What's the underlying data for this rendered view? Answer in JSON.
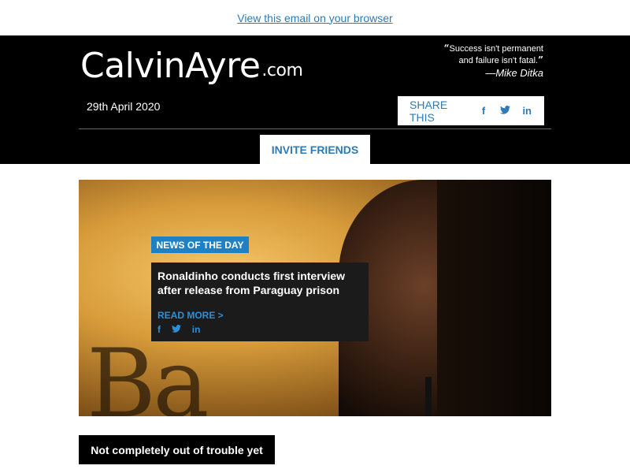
{
  "browser_link": "View this email on your browser",
  "header": {
    "logo_main": "CalvinAyre",
    "logo_suffix": ".com",
    "quote_line1": "Success isn't permanent",
    "quote_line2": "and failure isn't fatal.",
    "quote_open": "“",
    "quote_close": "”",
    "quote_author": "—Mike Ditka",
    "date": "29th April 2020",
    "share_label": "SHARE THIS",
    "share_icons": [
      "f",
      "twitter-icon",
      "in"
    ],
    "invite_label": "INVITE FRIENDS"
  },
  "hero": {
    "badge": "NEWS OF THE DAY",
    "headline": "Ronaldinho conducts first interview after release from Paraguay prison",
    "read_more": "READ MORE >",
    "social_icons": [
      "f",
      "twitter-icon",
      "in"
    ],
    "background_text": "Ba"
  },
  "section": {
    "subhead": "Not completely out of trouble yet"
  },
  "colors": {
    "accent": "#2d7ab5",
    "badge_bg": "#1f80c4",
    "header_bg": "#000000"
  }
}
